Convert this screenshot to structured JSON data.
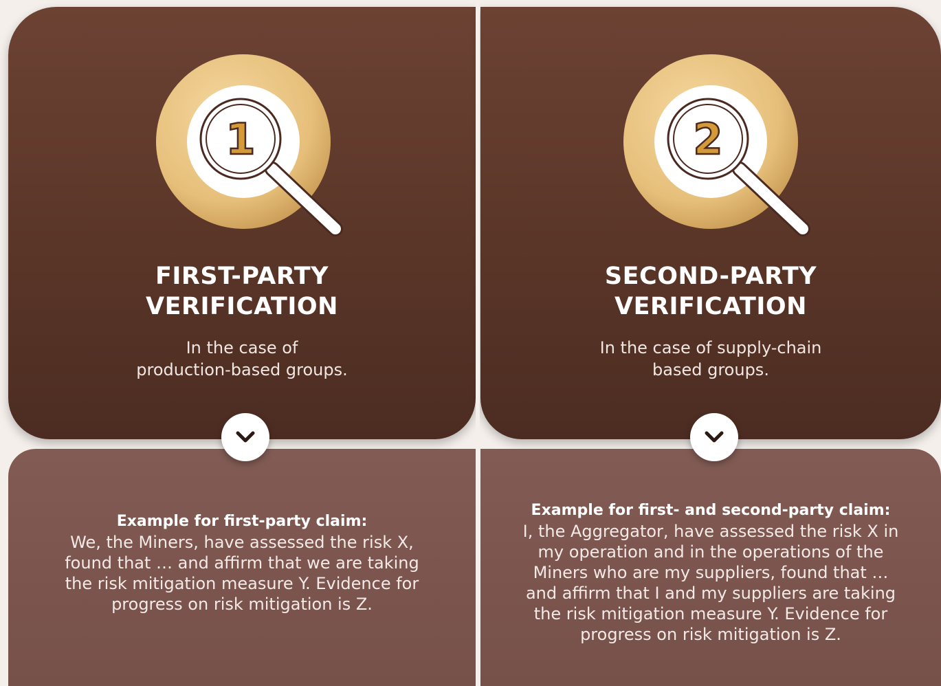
{
  "colors": {
    "badge_gold": "#e8c27e",
    "top_card": "#5a3628",
    "bottom_card": "#7d5750",
    "digit": "#d49a37"
  },
  "panels": [
    {
      "number": "1",
      "title_lines": [
        "FIRST-PARTY",
        "VERIFICATION"
      ],
      "subtitle_lines": [
        "In the case of",
        "production-based groups."
      ],
      "chevron_icon": "chevron-down-icon",
      "example_heading": "Example for first-party claim:",
      "example_lines": [
        "We, the Miners, have assessed the risk X,",
        "found that … and affirm that we are taking",
        "the risk mitigation measure Y. Evidence for",
        "progress on risk mitigation is Z."
      ]
    },
    {
      "number": "2",
      "title_lines": [
        "SECOND-PARTY",
        "VERIFICATION"
      ],
      "subtitle_lines": [
        "In the case of supply-chain",
        "based groups."
      ],
      "chevron_icon": "chevron-down-icon",
      "example_heading": "Example for first- and second-party claim:",
      "example_lines": [
        "I, the Aggregator, have assessed the risk X in",
        "my operation and in the operations of the",
        "Miners who are my suppliers, found that …",
        "and affirm that I and my suppliers are taking",
        "the risk mitigation measure Y. Evidence for",
        "progress on risk mitigation is Z."
      ]
    }
  ]
}
